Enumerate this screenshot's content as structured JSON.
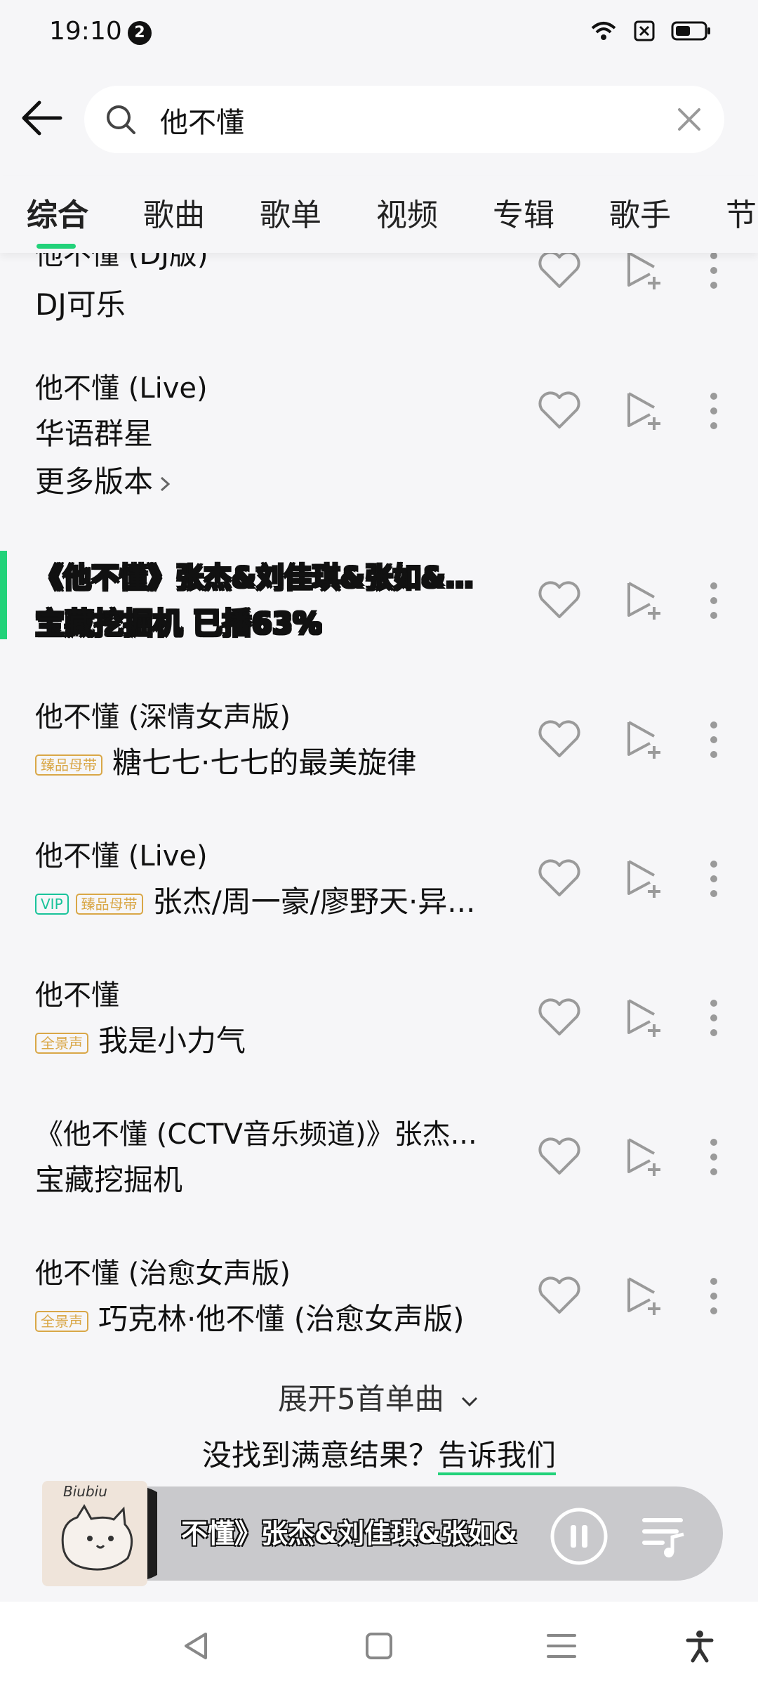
{
  "status_bar": {
    "time": "19:10",
    "notification_count": "2"
  },
  "search": {
    "query": "他不懂"
  },
  "tabs": [
    {
      "label": "综合"
    },
    {
      "label": "歌曲"
    },
    {
      "label": "歌单"
    },
    {
      "label": "视频"
    },
    {
      "label": "专辑"
    },
    {
      "label": "歌手"
    },
    {
      "label": "节"
    }
  ],
  "results": [
    {
      "title": "他不懂 (DJ版)",
      "artist": "DJ可乐"
    },
    {
      "title": "他不懂 (Live)",
      "artist": "华语群星",
      "more": "更多版本"
    },
    {
      "title": "《他不懂》张杰&刘佳琪&张如&张...",
      "artist": "宝藏挖掘机 已播63%",
      "playing": true
    },
    {
      "title": "他不懂 (深情女声版)",
      "badges": [
        "臻品母带"
      ],
      "artist": "糖七七·七七的最美旋律"
    },
    {
      "title": "他不懂 (Live)",
      "badges": [
        "VIP",
        "臻品母带"
      ],
      "artist": "张杰/周一豪/廖野天·异..."
    },
    {
      "title": "他不懂",
      "badges": [
        "全景声"
      ],
      "artist": "我是小力气"
    },
    {
      "title": "《他不懂 (CCTV音乐频道)》张杰...",
      "artist": "宝藏挖掘机"
    },
    {
      "title": "他不懂 (治愈女声版)",
      "badges": [
        "全景声"
      ],
      "artist": "巧克林·他不懂 (治愈女声版)"
    }
  ],
  "expand_label": "展开5首单曲",
  "feedback": {
    "text": "没找到满意结果？",
    "link": "告诉我们"
  },
  "player": {
    "cover_text": "Biubiu",
    "title": "不懂》张杰&刘佳琪&张如&张"
  },
  "colors": {
    "accent": "#22d27a",
    "badge_gold": "#d9a747",
    "badge_vip": "#19c39a"
  }
}
